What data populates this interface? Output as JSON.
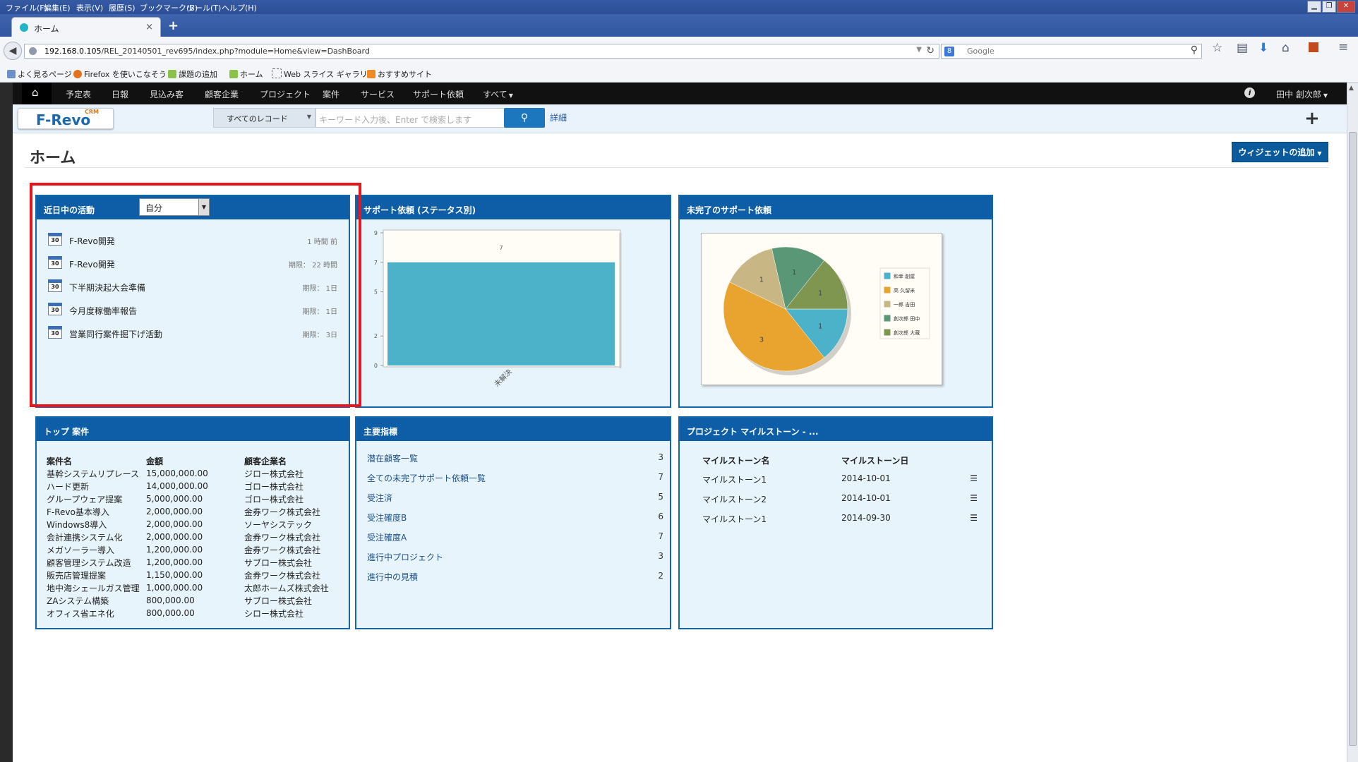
{
  "browser": {
    "menu": [
      "ファイル(F)",
      "編集(E)",
      "表示(V)",
      "履歴(S)",
      "ブックマーク(B)",
      "ツール(T)",
      "ヘルプ(H)"
    ],
    "tab_title": "ホーム",
    "url_host": "192.168.0.105",
    "url_path": "/REL_20140501_rev695/index.php?module=Home&view=DashBoard",
    "search_placeholder": "Google",
    "bookmarks": [
      "よく見るページ",
      "Firefox を使いこなそう",
      "課題の追加",
      "ホーム",
      "Web スライス ギャラリー",
      "おすすめサイト"
    ]
  },
  "app": {
    "nav": [
      "予定表",
      "日報",
      "見込み客",
      "顧客企業",
      "プロジェクト",
      "案件",
      "サービス",
      "サポート依頼",
      "すべて"
    ],
    "user": "田中 創次郎",
    "logo": "F-Revo",
    "logo_sub": "CRM",
    "record_select": "すべてのレコード",
    "keyword_placeholder": "キーワード入力後、Enter で検索します",
    "advanced": "詳細",
    "page_title": "ホーム",
    "add_widget": "ウィジェットの追加"
  },
  "activities": {
    "title": "近日中の活動",
    "owner": "自分",
    "items": [
      {
        "name": "F-Revo開発",
        "time": "1 時間 前"
      },
      {
        "name": "F-Revo開発",
        "time": "期限： 22 時間"
      },
      {
        "name": "下半期決起大会準備",
        "time": "期限： 1日"
      },
      {
        "name": "今月度稼働率報告",
        "time": "期限： 1日"
      },
      {
        "name": "営業同行案件掘下げ活動",
        "time": "期限： 3日"
      }
    ],
    "cal_label": "30"
  },
  "support_status": {
    "title": "サポート依頼 (ステータス別)",
    "chart_data": {
      "type": "bar",
      "categories": [
        "未解決"
      ],
      "values": [
        7
      ],
      "ylim": [
        0,
        9
      ],
      "yticks": [
        "9",
        "7",
        "5",
        "2",
        "0"
      ],
      "data_labels": [
        "7"
      ],
      "bar_color": "#4bb2c9"
    }
  },
  "open_support": {
    "title": "未完了のサポート依頼",
    "chart_data": {
      "type": "pie",
      "slices": [
        {
          "name": "和幸 創屋",
          "value": 1,
          "color": "#4bb2c9"
        },
        {
          "name": "高 久留米",
          "value": 3,
          "color": "#e9a32f"
        },
        {
          "name": "一郎 吉田",
          "value": 1,
          "color": "#c8b785"
        },
        {
          "name": "創次郎 田中",
          "value": 1,
          "color": "#5a9776"
        },
        {
          "name": "創次郎 大蔵",
          "value": 1,
          "color": "#7f9650"
        }
      ],
      "legend": "right"
    }
  },
  "top_deals": {
    "title": "トップ 案件",
    "headers": [
      "案件名",
      "金額",
      "顧客企業名"
    ],
    "rows": [
      [
        "基幹システムリプレース",
        "15,000,000.00",
        "ジロー株式会社"
      ],
      [
        "ハード更新",
        "14,000,000.00",
        "ゴロー株式会社"
      ],
      [
        "グループウェア提案",
        "5,000,000.00",
        "ゴロー株式会社"
      ],
      [
        "F-Revo基本導入",
        "2,000,000.00",
        "金券ワーク株式会社"
      ],
      [
        "Windows8導入",
        "2,000,000.00",
        "ソーヤシステック"
      ],
      [
        "会計連携システム化",
        "2,000,000.00",
        "金券ワーク株式会社"
      ],
      [
        "メガソーラー導入",
        "1,200,000.00",
        "金券ワーク株式会社"
      ],
      [
        "顧客管理システム改造",
        "1,200,000.00",
        "サブロー株式会社"
      ],
      [
        "販売店管理提案",
        "1,150,000.00",
        "金券ワーク株式会社"
      ],
      [
        "地中海シェールガス管理",
        "1,000,000.00",
        "太郎ホームズ株式会社"
      ],
      [
        "ZAシステム構築",
        "800,000.00",
        "サブロー株式会社"
      ],
      [
        "オフィス省エネ化",
        "800,000.00",
        "シロー株式会社"
      ]
    ]
  },
  "key_metrics": {
    "title": "主要指標",
    "items": [
      {
        "name": "潜在顧客一覧",
        "count": "3"
      },
      {
        "name": "全ての未完了サポート依頼一覧",
        "count": "7"
      },
      {
        "name": "受注済",
        "count": "5"
      },
      {
        "name": "受注確度B",
        "count": "6"
      },
      {
        "name": "受注確度A",
        "count": "7"
      },
      {
        "name": "進行中プロジェクト",
        "count": "3"
      },
      {
        "name": "進行中の見積",
        "count": "2"
      }
    ]
  },
  "milestones": {
    "title": "プロジェクト マイルストーン - ...",
    "headers": [
      "マイルストーン名",
      "マイルストーン日"
    ],
    "rows": [
      {
        "name": "マイルストーン1",
        "date": "2014-10-01"
      },
      {
        "name": "マイルストーン2",
        "date": "2014-10-01"
      },
      {
        "name": "マイルストーン1",
        "date": "2014-09-30"
      }
    ]
  }
}
